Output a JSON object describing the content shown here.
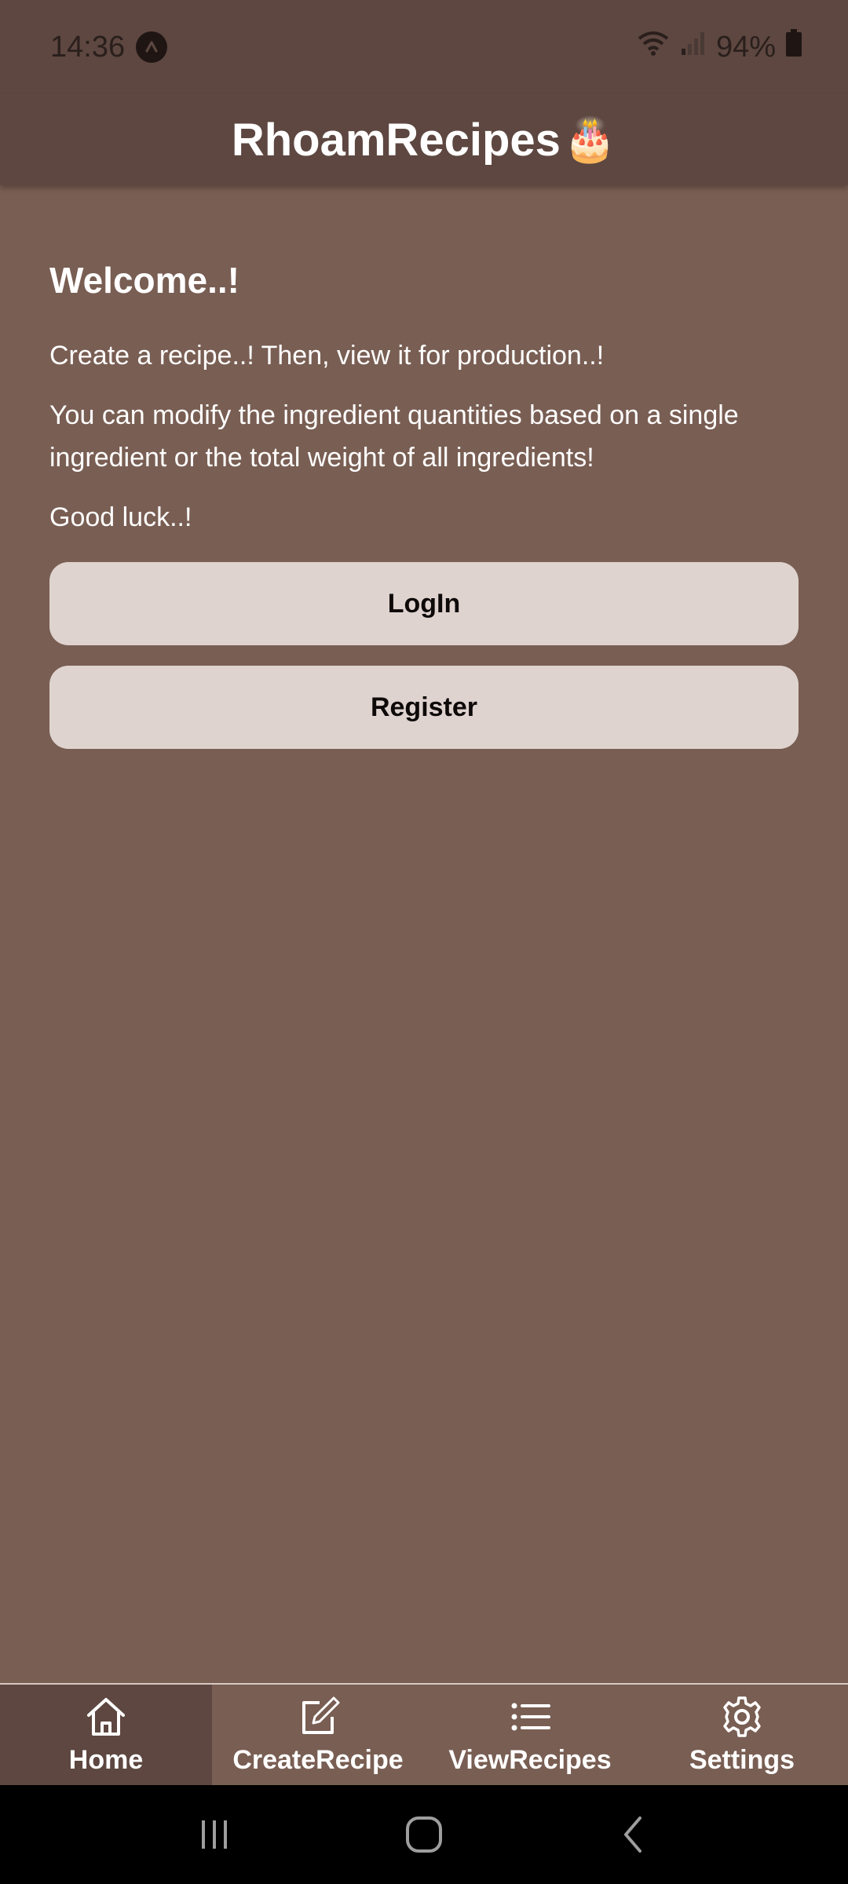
{
  "status_bar": {
    "time": "14:36",
    "battery": "94%",
    "icons": [
      "app-notification-icon",
      "wifi-icon",
      "signal-icon",
      "battery-icon"
    ]
  },
  "header": {
    "title": "RhoamRecipes",
    "emoji": "🎂"
  },
  "main": {
    "heading": "Welcome..!",
    "paragraphs": [
      "Create a recipe..! Then, view it for production..!",
      "You can modify the ingredient quantities based on a single ingredient or the total weight of all ingredients!",
      "Good luck..!"
    ],
    "login_label": "LogIn",
    "register_label": "Register"
  },
  "bottom_nav": {
    "items": [
      {
        "label": "Home",
        "icon": "home-icon"
      },
      {
        "label": "CreateRecipe",
        "icon": "edit-icon"
      },
      {
        "label": "ViewRecipes",
        "icon": "list-icon"
      },
      {
        "label": "Settings",
        "icon": "gear-icon"
      }
    ],
    "active": "Home"
  },
  "system_nav": {
    "icons": [
      "recents-icon",
      "home-circle-icon",
      "back-icon"
    ]
  },
  "colors": {
    "background": "#795e53",
    "header": "#5d4740",
    "button": "#dfd3cf"
  }
}
